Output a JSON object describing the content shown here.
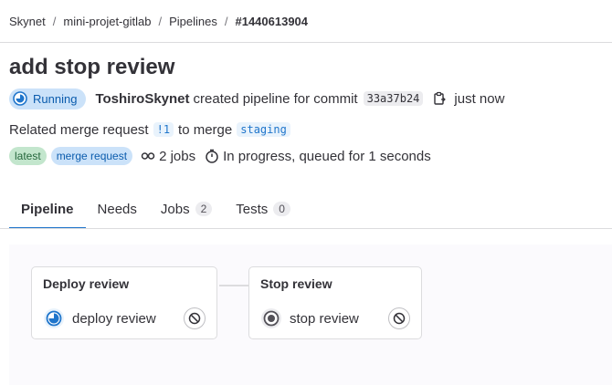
{
  "breadcrumb": {
    "items": [
      "Skynet",
      "mini-projet-gitlab",
      "Pipelines"
    ],
    "separator": "/",
    "current": "#1440613904"
  },
  "title": "add stop review",
  "meta": {
    "status": "Running",
    "user": "ToshiroSkynet",
    "action_text": "created pipeline for commit",
    "sha": "33a37b24",
    "time": "just now"
  },
  "merge_request": {
    "prefix": "Related merge request",
    "id": "!1",
    "middle": "to merge",
    "branch": "staging"
  },
  "tags": {
    "latest": "latest",
    "merge_request": "merge request",
    "jobs": "2 jobs",
    "progress": "In progress, queued for 1 seconds"
  },
  "tabs": [
    {
      "label": "Pipeline",
      "count": null
    },
    {
      "label": "Needs",
      "count": null
    },
    {
      "label": "Jobs",
      "count": "2"
    },
    {
      "label": "Tests",
      "count": "0"
    }
  ],
  "stages": [
    {
      "title": "Deploy review",
      "job": "deploy review",
      "status_icon": "running-status-icon",
      "action_icon": "cancel-icon"
    },
    {
      "title": "Stop review",
      "job": "stop review",
      "status_icon": "manual-status-icon",
      "action_icon": "cancel-icon"
    }
  ],
  "colors": {
    "accent": "#1f75cb",
    "running_badge_bg": "#cbe2f9",
    "latest_badge_bg": "#c3e6cd"
  }
}
